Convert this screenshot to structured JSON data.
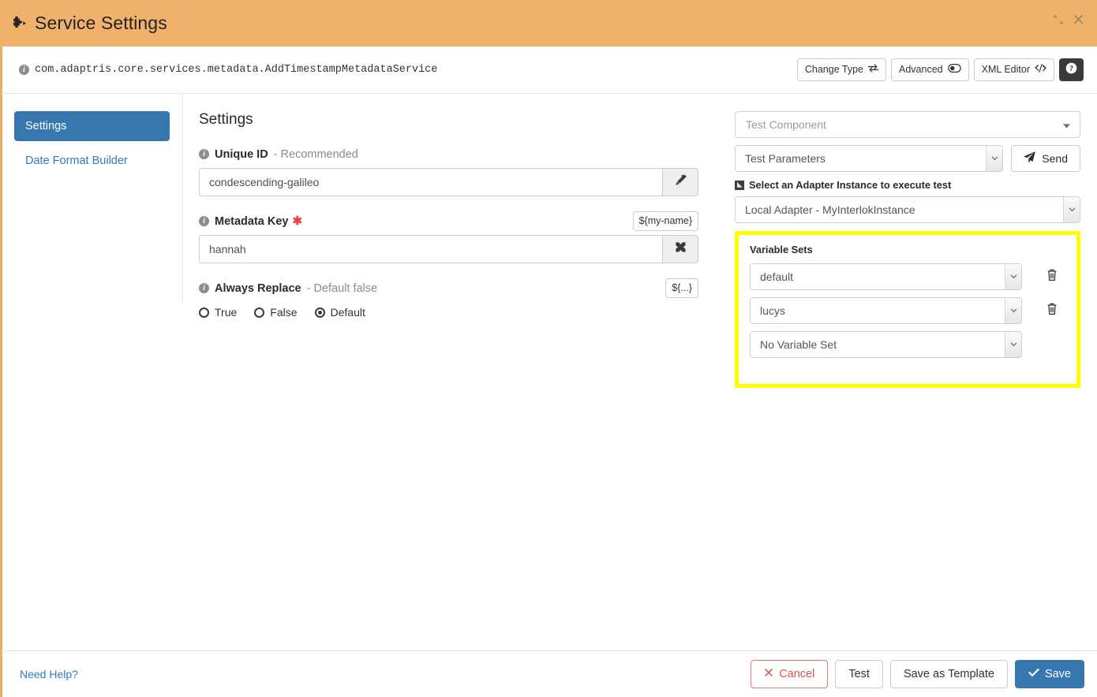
{
  "header": {
    "title": "Service Settings",
    "icon": "puzzle-piece-icon",
    "bg_color": "#f0b26b",
    "minimize_icon": "compress-arrows-icon",
    "close_icon": "close-icon"
  },
  "subheader": {
    "class_name": "com.adaptris.core.services.metadata.AddTimestampMetadataService",
    "info_icon": "info-circle-icon",
    "buttons": [
      {
        "label": "Change Type",
        "icon": "exchange-arrows-icon"
      },
      {
        "label": "Advanced",
        "icon": "toggle-off-icon"
      },
      {
        "label": "XML Editor",
        "icon": "code-icon"
      }
    ],
    "help_button": {
      "label": "?",
      "icon": "question-circle-icon"
    }
  },
  "sidebar": {
    "items": [
      {
        "label": "Settings",
        "active": true
      },
      {
        "label": "Date Format Builder",
        "active": false
      }
    ],
    "active_color": "#3777b0"
  },
  "form": {
    "section_title": "Settings",
    "fields": [
      {
        "label": "Unique ID",
        "suffix": "- Recommended",
        "required": false,
        "value": "condescending-galileo",
        "addon_icon": "magic-wand-icon",
        "badge": null
      },
      {
        "label": "Metadata Key",
        "suffix": "",
        "required": true,
        "value": "hannah",
        "addon_icon": "shuffle-icon",
        "badge": "${my-name}"
      }
    ],
    "always_replace": {
      "label": "Always Replace",
      "suffix": "- Default false",
      "badge": "${...}",
      "options": [
        {
          "label": "True",
          "selected": false
        },
        {
          "label": "False",
          "selected": false
        },
        {
          "label": "Default",
          "selected": true
        }
      ]
    }
  },
  "test_panel": {
    "component_select": {
      "placeholder": "Test Component",
      "value": ""
    },
    "parameters_select": {
      "value": "Test Parameters"
    },
    "send_button": {
      "label": "Send",
      "icon": "paper-plane-icon"
    },
    "adapter_label": "Select an Adapter Instance to execute test",
    "adapter_label_icon": "collapse-square-icon",
    "adapter_select": {
      "value": "Local Adapter - MyInterlokInstance"
    },
    "variable_sets": {
      "title": "Variable Sets",
      "highlight_color": "#ffff00",
      "rows": [
        {
          "value": "default",
          "has_delete": true,
          "delete_icon": "trash-icon"
        },
        {
          "value": "lucys",
          "has_delete": true,
          "delete_icon": "trash-icon"
        },
        {
          "value": "No Variable Set",
          "has_delete": false,
          "delete_icon": ""
        }
      ]
    }
  },
  "footer": {
    "help_link": "Need Help?",
    "buttons": [
      {
        "label": "Cancel",
        "icon": "x-mark-icon",
        "style": "cancel"
      },
      {
        "label": "Test",
        "icon": "",
        "style": "default"
      },
      {
        "label": "Save as Template",
        "icon": "",
        "style": "default"
      },
      {
        "label": "Save",
        "icon": "check-icon",
        "style": "primary"
      }
    ],
    "save_color": "#3777b0",
    "cancel_color": "#d9534f"
  }
}
